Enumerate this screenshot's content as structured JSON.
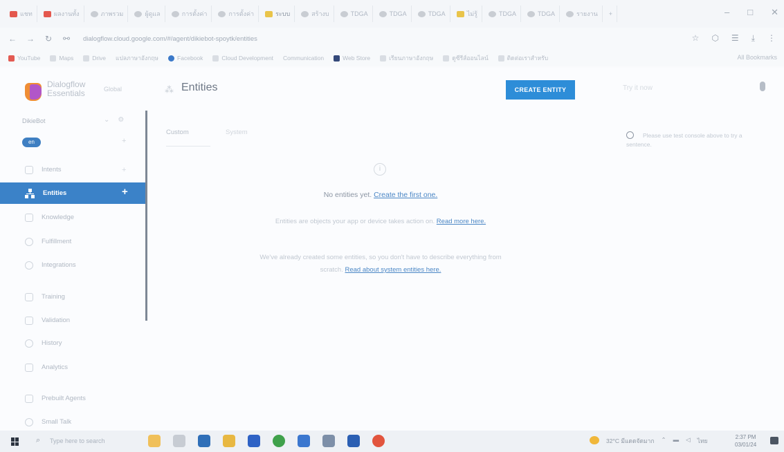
{
  "browser": {
    "tabs": [
      "แชท",
      "ผลงานทั้ง",
      "ภาพรวม",
      "ผู้ดูแล",
      "การตั้งค่า",
      "การตั้งค่า",
      "ระบบ",
      "สร้างบ",
      "TDGA",
      "TDGA",
      "TDGA",
      "ไม่รู้",
      "TDGA",
      "TDGA",
      "รายงาน"
    ],
    "new_tab": "+",
    "window_controls": [
      "–",
      "□",
      "✕"
    ],
    "url": "dialogflow.cloud.google.com/#/agent/dikiebot-spoytk/entities",
    "bookmarks": [
      "YouTube",
      "Maps",
      "Drive",
      "แปลภาษาอังกฤษ",
      "Facebook",
      "Cloud Development",
      "Communication",
      "Web Store",
      "เรียนภาษาอังกฤษ",
      "ดูซีรีส์ออนไลน์",
      "ติดต่อเราสำหรับ"
    ],
    "all_bookmarks": "All Bookmarks"
  },
  "sidebar": {
    "brand_line1": "Dialogflow",
    "brand_line2": "Essentials",
    "region": "Global",
    "agent": "DikieBot",
    "language": "en",
    "items": [
      {
        "label": "Intents"
      },
      {
        "label": "Entities"
      },
      {
        "label": "Knowledge"
      },
      {
        "label": "Fulfillment"
      },
      {
        "label": "Integrations"
      },
      {
        "label": "Training"
      },
      {
        "label": "Validation"
      },
      {
        "label": "History"
      },
      {
        "label": "Analytics"
      },
      {
        "label": "Prebuilt Agents"
      },
      {
        "label": "Small Talk"
      }
    ]
  },
  "main": {
    "title": "Entities",
    "create_button": "CREATE ENTITY",
    "tabs": [
      "Custom",
      "System"
    ],
    "empty_state": {
      "line1": "No entities yet.",
      "line1_link": "Create the first one.",
      "para2": "Entities are objects your app or device takes action on.",
      "para2_link": "Read more here.",
      "para3": "We've already created some entities, so you don't have to describe everything from scratch.",
      "para3_link": "Read about system entities here."
    }
  },
  "console": {
    "placeholder": "Try it now",
    "tip": "Please use test console above to try a sentence."
  },
  "taskbar": {
    "search_placeholder": "Type here to search",
    "weather": "32°C มีแดดจัดมาก",
    "language": "ไทย",
    "time": "2:37 PM",
    "date": "03/01/24"
  }
}
